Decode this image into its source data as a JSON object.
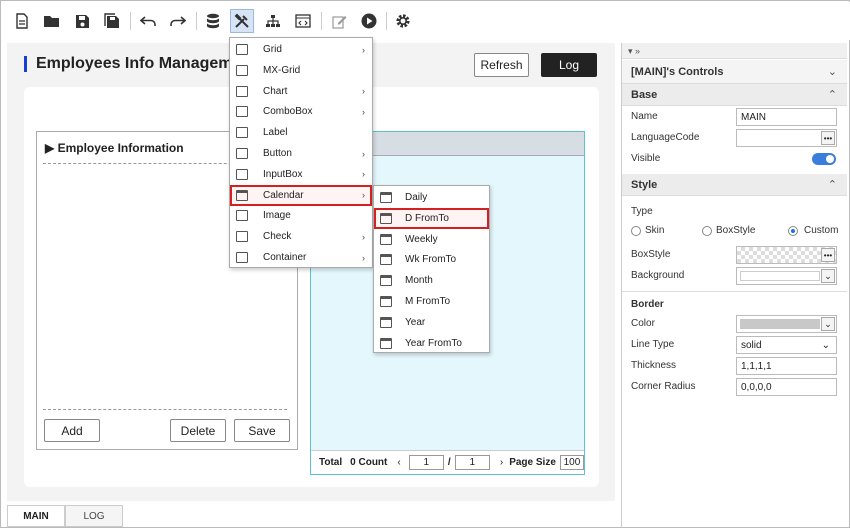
{
  "toolbar": {
    "buttons": [
      "new-file",
      "open-folder",
      "save",
      "save-all",
      "undo",
      "redo",
      "database",
      "tools",
      "hierarchy",
      "code",
      "edit",
      "run",
      "settings"
    ]
  },
  "page": {
    "title": "Employees Info Managem",
    "refresh_label": "Refresh",
    "log_label": "Log"
  },
  "left_panel": {
    "title": "Employee Information",
    "add_label": "Add",
    "delete_label": "Delete",
    "save_label": "Save"
  },
  "grid": {
    "total_label": "Total",
    "count_text": "0 Count",
    "page_current": "1",
    "page_sep": "/",
    "page_total": "1",
    "page_size_label": "Page Size",
    "page_size_value": "100"
  },
  "menu": {
    "items": [
      {
        "label": "Grid",
        "submenu": true
      },
      {
        "label": "MX-Grid",
        "submenu": false
      },
      {
        "label": "Chart",
        "submenu": true
      },
      {
        "label": "ComboBox",
        "submenu": true
      },
      {
        "label": "Label",
        "submenu": false
      },
      {
        "label": "Button",
        "submenu": true
      },
      {
        "label": "InputBox",
        "submenu": true
      },
      {
        "label": "Calendar",
        "submenu": true
      },
      {
        "label": "Image",
        "submenu": false
      },
      {
        "label": "Check",
        "submenu": true
      },
      {
        "label": "Container",
        "submenu": true
      }
    ],
    "highlighted": "Calendar"
  },
  "submenu": {
    "items": [
      "Daily",
      "D FromTo",
      "Weekly",
      "Wk FromTo",
      "Month",
      "M FromTo",
      "Year",
      "Year FromTo"
    ],
    "highlighted": "D FromTo"
  },
  "bottom_tabs": [
    "MAIN",
    "LOG"
  ],
  "right_panel": {
    "pin_label": "▾ »",
    "controls_title": "[MAIN]'s Controls",
    "base_header": "Base",
    "name_label": "Name",
    "name_value": "MAIN",
    "languagecode_label": "LanguageCode",
    "languagecode_value": "",
    "visible_label": "Visible",
    "visible_value": true,
    "style_header": "Style",
    "type_label": "Type",
    "type_options": [
      "Skin",
      "BoxStyle",
      "Custom"
    ],
    "type_selected": "Custom",
    "boxstyle_label": "BoxStyle",
    "background_label": "Background",
    "border_header": "Border",
    "color_label": "Color",
    "linetype_label": "Line Type",
    "linetype_value": "solid",
    "thickness_label": "Thickness",
    "thickness_value": "1,1,1,1",
    "cornerradius_label": "Corner Radius",
    "cornerradius_value": "0,0,0,0"
  },
  "colors": {
    "accent": "#1a3fd0",
    "highlight": "#d32020",
    "toggle": "#3b7ddd",
    "grid_bg": "#e3f7fd"
  }
}
